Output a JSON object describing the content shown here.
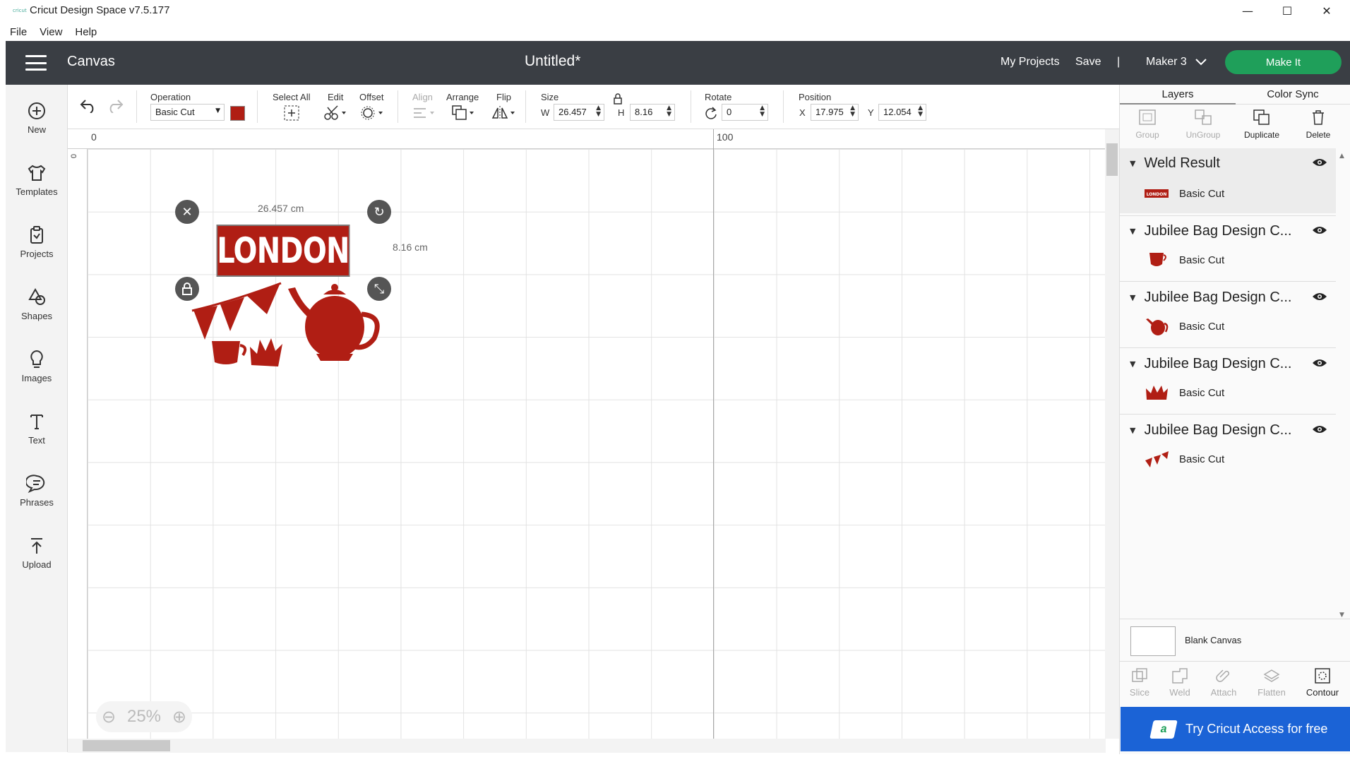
{
  "window": {
    "app_title": "Cricut Design Space  v7.5.177",
    "minimize": "—",
    "maximize": "☐",
    "close": "✕"
  },
  "menu": [
    "File",
    "View",
    "Help"
  ],
  "header": {
    "section": "Canvas",
    "document_title": "Untitled*",
    "my_projects": "My Projects",
    "save": "Save",
    "divider": "|",
    "machine": "Maker 3",
    "make_it": "Make It"
  },
  "sidebar": [
    {
      "label": "New",
      "icon": "plus-circle-icon"
    },
    {
      "label": "Templates",
      "icon": "tshirt-icon"
    },
    {
      "label": "Projects",
      "icon": "clipboard-icon"
    },
    {
      "label": "Shapes",
      "icon": "shapes-icon"
    },
    {
      "label": "Images",
      "icon": "lightbulb-icon"
    },
    {
      "label": "Text",
      "icon": "text-icon"
    },
    {
      "label": "Phrases",
      "icon": "speech-bubble-icon"
    },
    {
      "label": "Upload",
      "icon": "upload-icon"
    }
  ],
  "toolbar": {
    "operation_label": "Operation",
    "operation_value": "Basic Cut",
    "operation_color": "#b01e14",
    "select_all": "Select All",
    "edit": "Edit",
    "offset": "Offset",
    "align": "Align",
    "arrange": "Arrange",
    "flip": "Flip",
    "size_label": "Size",
    "w_prefix": "W",
    "width": "26.457",
    "h_prefix": "H",
    "height": "8.16",
    "rotate_label": "Rotate",
    "rotate": "0",
    "position_label": "Position",
    "x_prefix": "X",
    "x": "17.975",
    "y_prefix": "Y",
    "y": "12.054"
  },
  "ruler": {
    "top_ticks": [
      "0",
      "100"
    ],
    "left_ticks": [
      "0"
    ]
  },
  "canvas": {
    "width_label": "26.457 cm",
    "height_label": "8.16 cm",
    "banner_text": "LONDON",
    "zoom": "25%",
    "design_color": "#b01e14"
  },
  "right_panel": {
    "tabs": [
      "Layers",
      "Color Sync"
    ],
    "tools": [
      "Group",
      "UnGroup",
      "Duplicate",
      "Delete"
    ],
    "layers": [
      {
        "name": "Weld Result",
        "operation": "Basic Cut",
        "thumb": "london-banner-thumbnail"
      },
      {
        "name": "Jubilee Bag Design C...",
        "operation": "Basic Cut",
        "thumb": "teacup-thumbnail"
      },
      {
        "name": "Jubilee Bag Design C...",
        "operation": "Basic Cut",
        "thumb": "teapot-thumbnail"
      },
      {
        "name": "Jubilee Bag Design C...",
        "operation": "Basic Cut",
        "thumb": "crown-thumbnail"
      },
      {
        "name": "Jubilee Bag Design C...",
        "operation": "Basic Cut",
        "thumb": "bunting-thumbnail"
      }
    ],
    "blank_canvas": "Blank Canvas",
    "bottom_tools": [
      "Slice",
      "Weld",
      "Attach",
      "Flatten",
      "Contour"
    ],
    "access_banner": "Try Cricut Access for free",
    "access_icon_letter": "a"
  }
}
